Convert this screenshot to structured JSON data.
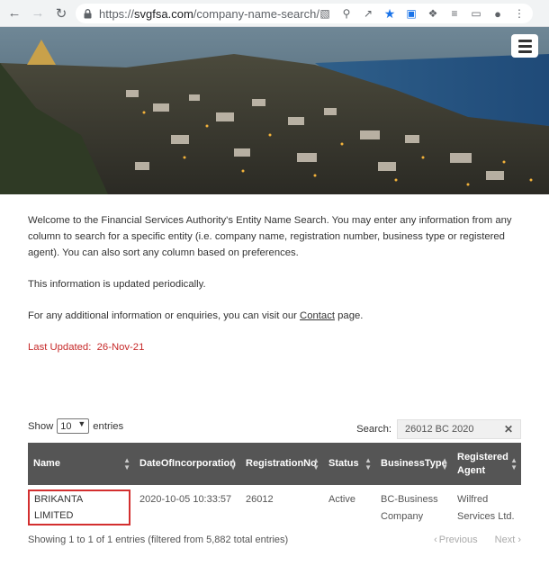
{
  "browser": {
    "back_icon": "back-arrow-icon",
    "forward_icon": "forward-arrow-icon",
    "reload_icon": "reload-icon",
    "url_scheme": "https://",
    "url_host": "svgfsa.com",
    "url_path": "/company-name-search/"
  },
  "intro": {
    "welcome": "Welcome to the Financial Services Authority's Entity Name Search. You may enter any information from any column to search for a specific entity (i.e. company name, registration number, business type or registered agent). You can also sort any column based on preferences.",
    "updated_note": "This information is updated periodically.",
    "enquiry_prefix": "For any additional information or enquiries, you can visit our ",
    "contact_link": "Contact",
    "enquiry_suffix": " page.",
    "last_updated_label": "Last Updated:",
    "last_updated_value": "26-Nov-21"
  },
  "controls": {
    "show_label": "Show",
    "entries_value": "10",
    "entries_label": "entries",
    "search_label": "Search:",
    "search_value": "26012 BC 2020"
  },
  "table": {
    "headers": [
      "Name",
      "DateOfIncorporation",
      "RegistrationNo",
      "Status",
      "BusinessType",
      "Registered Agent"
    ],
    "rows": [
      {
        "name": "BRIKANTA LIMITED",
        "date": "2020-10-05 10:33:57",
        "regno": "26012",
        "status": "Active",
        "btype": "BC-Business Company",
        "agent": "Wilfred Services Ltd."
      }
    ]
  },
  "footer": {
    "info": "Showing 1 to 1 of 1 entries (filtered from 5,882 total entries)",
    "previous": "Previous",
    "next": "Next"
  }
}
